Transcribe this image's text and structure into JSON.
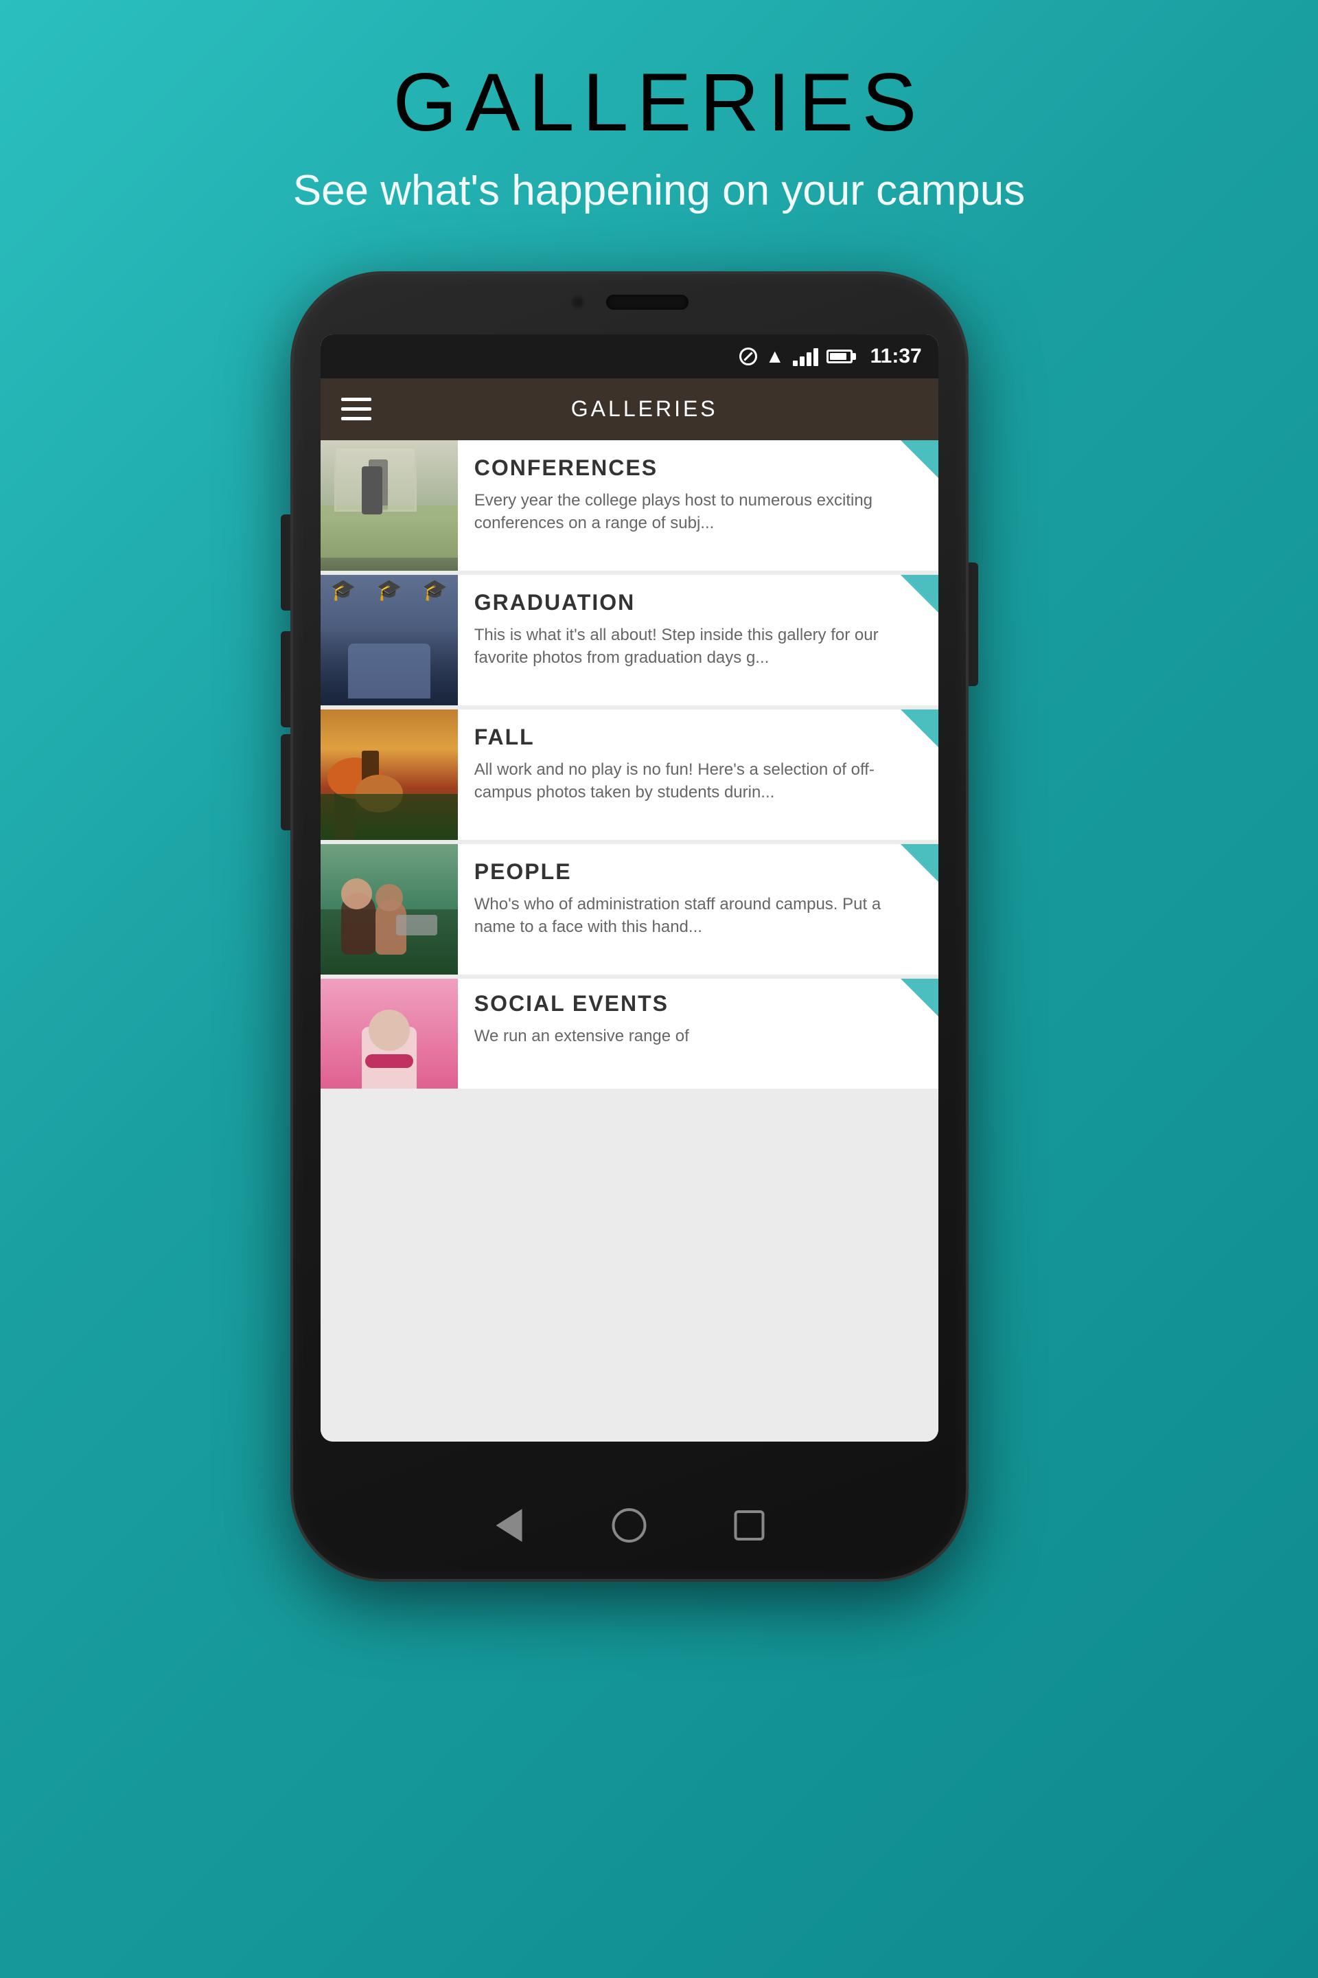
{
  "page": {
    "background_color": "#2bbfbf",
    "header": {
      "title": "GALLERIES",
      "subtitle": "See what's happening on your campus"
    },
    "phone": {
      "status_bar": {
        "time": "11:37",
        "icons": [
          "signal",
          "wifi",
          "battery"
        ]
      },
      "app_bar": {
        "title": "GALLERIES",
        "menu_icon": "hamburger"
      },
      "gallery_items": [
        {
          "id": "conferences",
          "title": "CONFERENCES",
          "description": "Every year the college plays host to numerous exciting conferences on a range of subj...",
          "thumb_type": "conferences"
        },
        {
          "id": "graduation",
          "title": "GRADUATION",
          "description": "This is what it's all about!  Step inside this gallery for our favorite photos from graduation days g...",
          "thumb_type": "graduation"
        },
        {
          "id": "fall",
          "title": "FALL",
          "description": "All work and no play is no fun!  Here's a selection of off-campus photos taken by students durin...",
          "thumb_type": "fall"
        },
        {
          "id": "people",
          "title": "PEOPLE",
          "description": "Who's who of administration staff around campus.  Put a name to a face with this hand...",
          "thumb_type": "people"
        },
        {
          "id": "social-events",
          "title": "SOCIAL EVENTS",
          "description": "We run an extensive range of",
          "thumb_type": "social"
        }
      ],
      "nav_bar": {
        "back_label": "back",
        "home_label": "home",
        "recents_label": "recents"
      }
    }
  }
}
